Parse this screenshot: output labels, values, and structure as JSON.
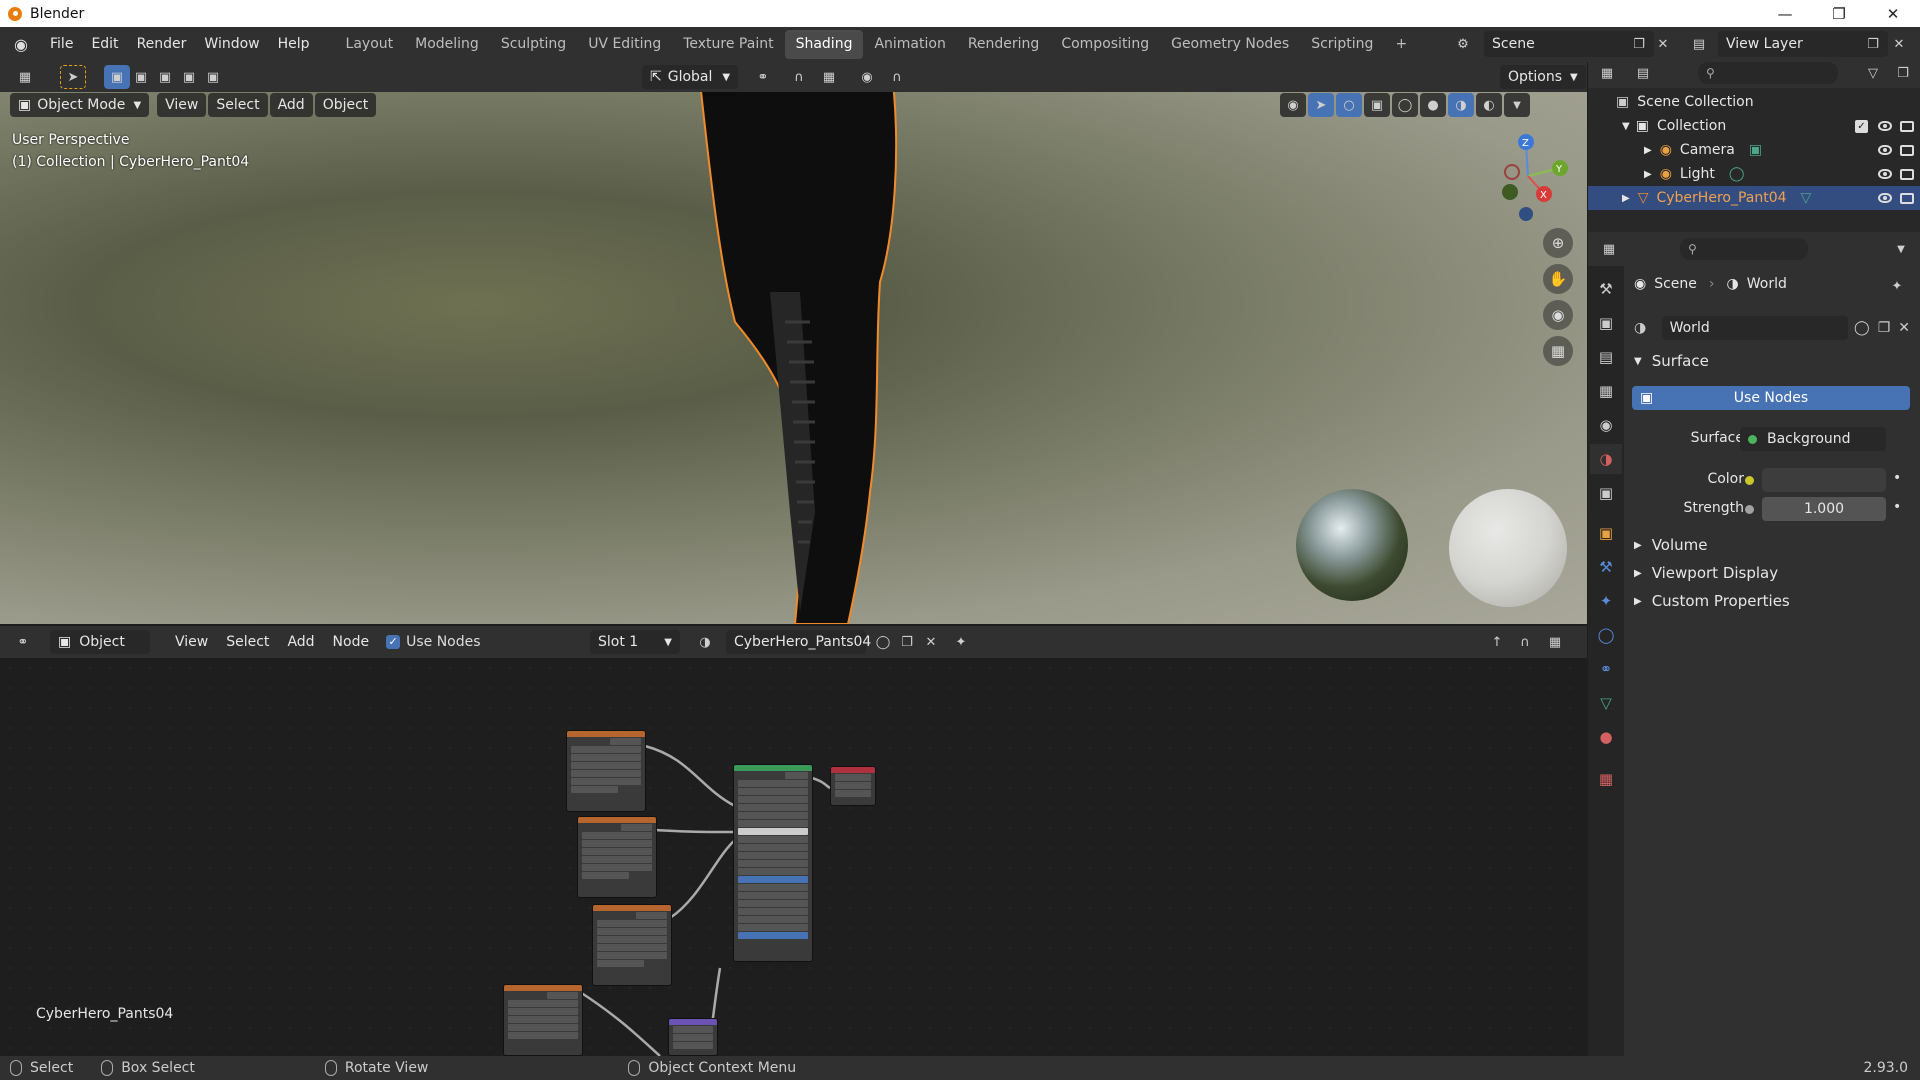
{
  "window": {
    "title": "Blender"
  },
  "menus": [
    "File",
    "Edit",
    "Render",
    "Window",
    "Help"
  ],
  "workspaces": [
    "Layout",
    "Modeling",
    "Sculpting",
    "UV Editing",
    "Texture Paint",
    "Shading",
    "Animation",
    "Rendering",
    "Compositing",
    "Geometry Nodes",
    "Scripting"
  ],
  "active_workspace": "Shading",
  "scene": {
    "name": "Scene",
    "view_layer": "View Layer"
  },
  "viewport": {
    "mode": "Object Mode",
    "menu": [
      "View",
      "Select",
      "Add",
      "Object"
    ],
    "transform_orientation": "Global",
    "options_label": "Options",
    "overlay_line1": "User Perspective",
    "overlay_line2": "(1) Collection | CyberHero_Pant04",
    "gizmo": {
      "x": "X",
      "y": "Y",
      "z": "Z"
    }
  },
  "node_editor": {
    "type": "Object",
    "menu": [
      "View",
      "Select",
      "Add",
      "Node"
    ],
    "use_nodes_label": "Use Nodes",
    "slot": "Slot 1",
    "material": "CyberHero_Pants04",
    "corner_label": "CyberHero_Pants04"
  },
  "outliner": {
    "rows": [
      {
        "label": "Scene Collection"
      },
      {
        "label": "Collection"
      },
      {
        "label": "Camera"
      },
      {
        "label": "Light"
      },
      {
        "label": "CyberHero_Pant04"
      }
    ]
  },
  "properties": {
    "breadcrumb_scene": "Scene",
    "breadcrumb_world": "World",
    "world_name": "World",
    "surface_section": "Surface",
    "use_nodes_button": "Use Nodes",
    "surface_label": "Surface",
    "surface_value": "Background",
    "color_label": "Color",
    "strength_label": "Strength",
    "strength_value": "1.000",
    "volume_section": "Volume",
    "viewport_display_section": "Viewport Display",
    "custom_properties_section": "Custom Properties"
  },
  "statusbar": {
    "select": "Select",
    "box_select": "Box Select",
    "rotate_view": "Rotate View",
    "context_menu": "Object Context Menu",
    "version": "2.93.0"
  },
  "colors": {
    "accent": "#4772b3",
    "selection_outline": "#f08b2a",
    "active_row": "#334d80"
  }
}
